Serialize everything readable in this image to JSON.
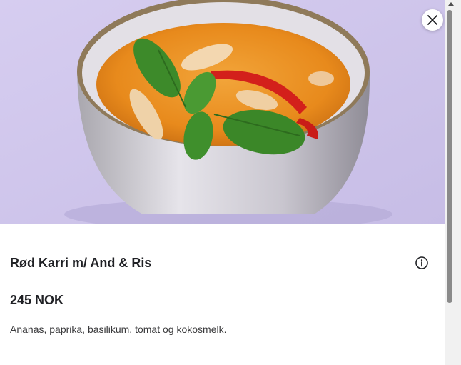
{
  "dish": {
    "title": "Rød Karri m/ And & Ris",
    "price": "245 NOK",
    "description": "Ananas, paprika, basilikum, tomat og kokosmelk."
  },
  "icons": {
    "close": "close-icon",
    "info": "info-icon"
  },
  "colors": {
    "background_lavender": "#cfc6ea",
    "curry_orange": "#e8921f",
    "text_dark": "#202125"
  }
}
